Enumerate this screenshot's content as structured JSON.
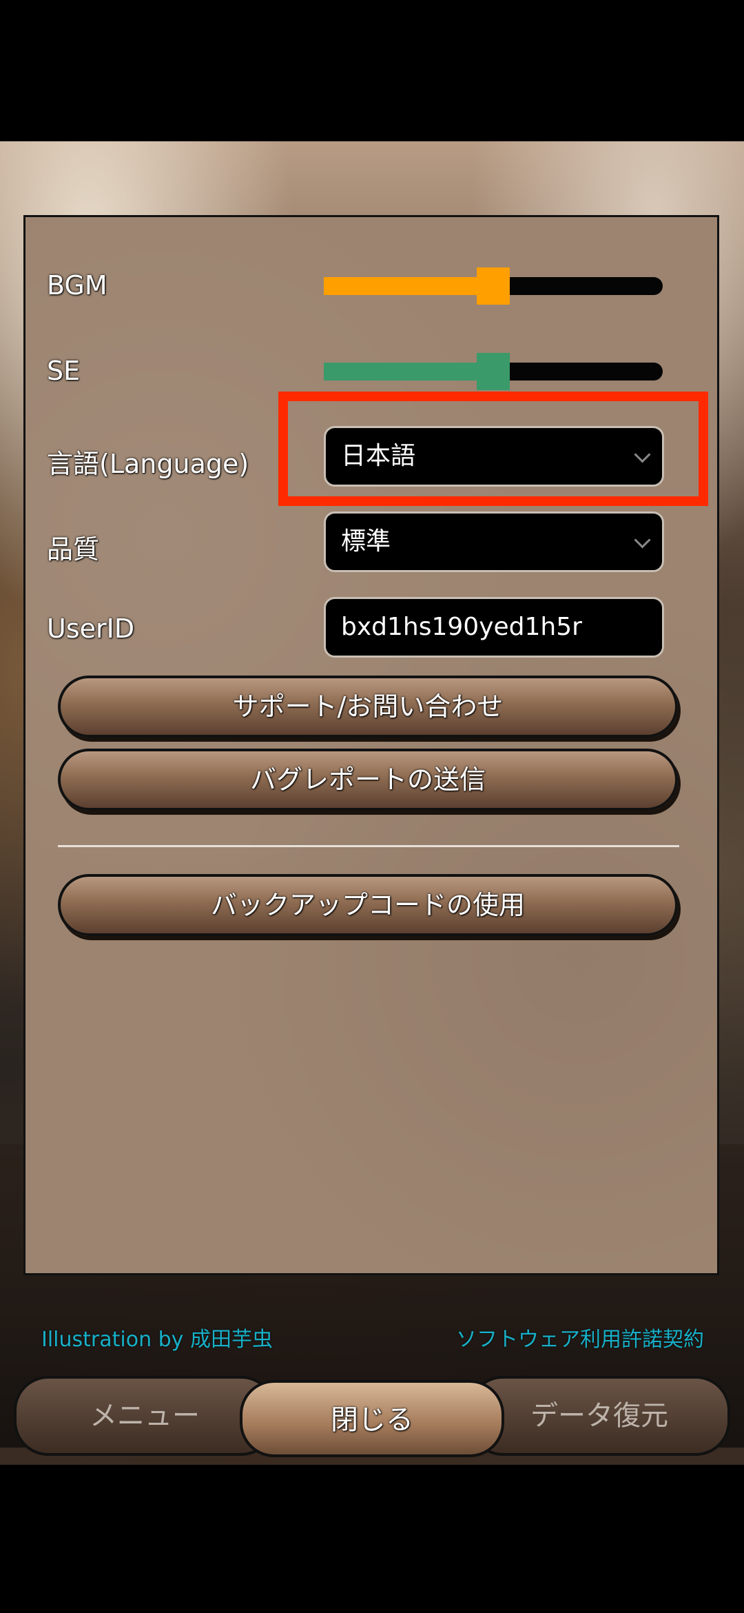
{
  "settings": {
    "bgm": {
      "label": "BGM",
      "level": 0.5,
      "color": "#ff9f00"
    },
    "se": {
      "label": "SE",
      "level": 0.5,
      "color": "#3a9a6a"
    },
    "language": {
      "label": "言語(Language)",
      "value": "日本語"
    },
    "quality": {
      "label": "品質",
      "value": "標準"
    },
    "userid": {
      "label": "UserID",
      "value": "bxd1hs190yed1h5r"
    }
  },
  "buttons": {
    "support": "サポート/お問い合わせ",
    "bug_report": "バグレポートの送信",
    "backup_code": "バックアップコードの使用"
  },
  "footer": {
    "illustration_credit": "Illustration by 成田芋虫",
    "license_link": "ソフトウェア利用許諾契約"
  },
  "tabs": {
    "menu": "メニュー",
    "close": "閉じる",
    "data_restore": "データ復元"
  },
  "colors": {
    "highlight": "#ff2a00",
    "panel": "#9c8470",
    "credit_text": "#18b0c8"
  }
}
